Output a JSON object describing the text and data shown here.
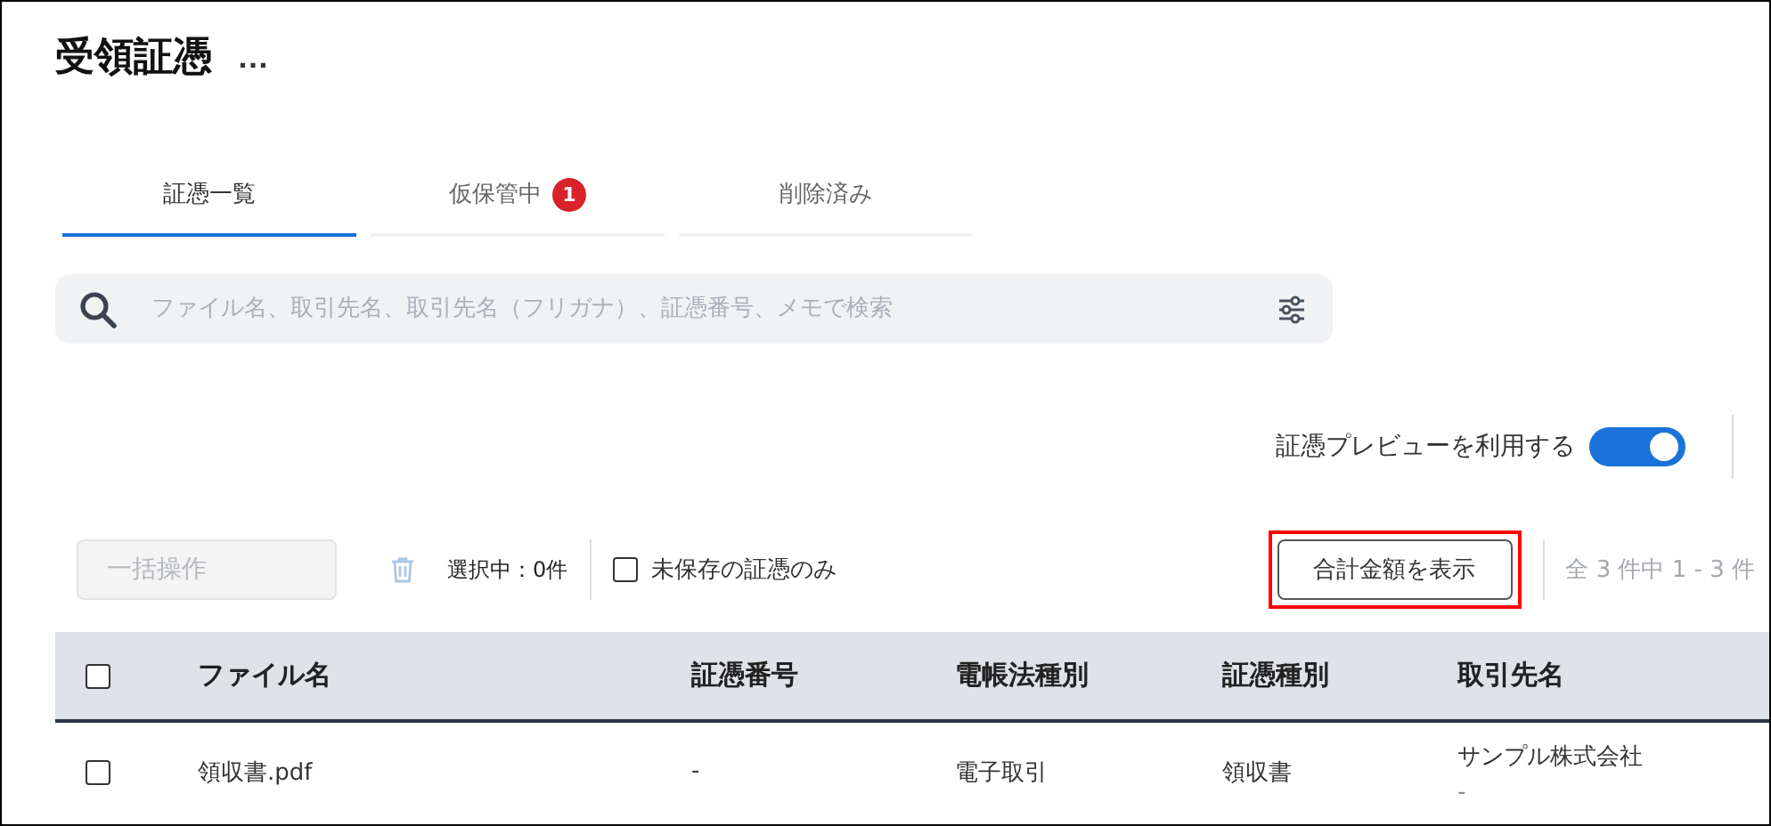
{
  "page": {
    "title": "受領証憑",
    "more_menu": "…"
  },
  "tabs": [
    {
      "label": "証憑一覧",
      "selected": true
    },
    {
      "label": "仮保管中",
      "selected": false,
      "badge": "1"
    },
    {
      "label": "削除済み",
      "selected": false
    }
  ],
  "search": {
    "placeholder": "ファイル名、取引先名、取引先名（フリガナ）、証憑番号、メモで検索"
  },
  "preview_toggle": {
    "label": "証憑プレビューを利用する",
    "on": true
  },
  "toolbar": {
    "bulk_button": {
      "label": "一括操作",
      "disabled": true
    },
    "delete_disabled": true,
    "selection_count": "選択中：0件",
    "unsaved_only": {
      "label": "未保存の証憑のみ",
      "checked": false
    },
    "total_button": {
      "label": "合計金額を表示",
      "highlighted": true
    },
    "pagination": "全 3 件中 1 - 3 件"
  },
  "table": {
    "all_checked": false,
    "columns": [
      "ファイル名",
      "証憑番号",
      "電帳法種別",
      "証憑種別",
      "取引先名"
    ],
    "rows": [
      {
        "checked": false,
        "cells": [
          "領収書.pdf",
          "-",
          "電子取引",
          "領収書",
          "サンプル株式会社"
        ],
        "cell_note": "-"
      }
    ]
  }
}
